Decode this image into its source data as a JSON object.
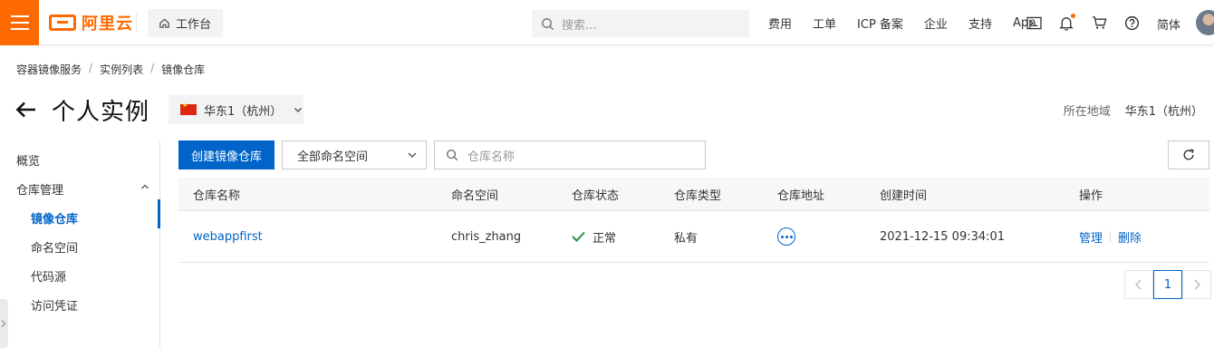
{
  "topbar": {
    "logo_text": "阿里云",
    "workbench_label": "工作台",
    "search_placeholder": "搜索...",
    "links": [
      "费用",
      "工单",
      "ICP 备案",
      "企业",
      "支持",
      "App"
    ],
    "lang": "简体",
    "brand_color": "#ff6a00"
  },
  "breadcrumb": [
    "容器镜像服务",
    "实例列表",
    "镜像仓库"
  ],
  "page": {
    "title": "个人实例",
    "region_selected": "华东1（杭州）",
    "region_label": "所在地域",
    "region_value": "华东1（杭州）"
  },
  "sidebar": {
    "overview": "概览",
    "repo_mgmt": "仓库管理",
    "items": [
      "镜像仓库",
      "命名空间",
      "代码源",
      "访问凭证"
    ]
  },
  "toolbar": {
    "create_label": "创建镜像仓库",
    "namespace_selected": "全部命名空间",
    "search_placeholder": "仓库名称",
    "accent": "#0064c8"
  },
  "table": {
    "headers": [
      "仓库名称",
      "命名空间",
      "仓库状态",
      "仓库类型",
      "仓库地址",
      "创建时间",
      "操作"
    ],
    "rows": [
      {
        "name": "webappfirst",
        "namespace": "chris_zhang",
        "status": "正常",
        "type": "私有",
        "created": "2021-12-15 09:34:01",
        "op_manage": "管理",
        "op_delete": "删除"
      }
    ]
  },
  "pagination": {
    "current": "1"
  }
}
